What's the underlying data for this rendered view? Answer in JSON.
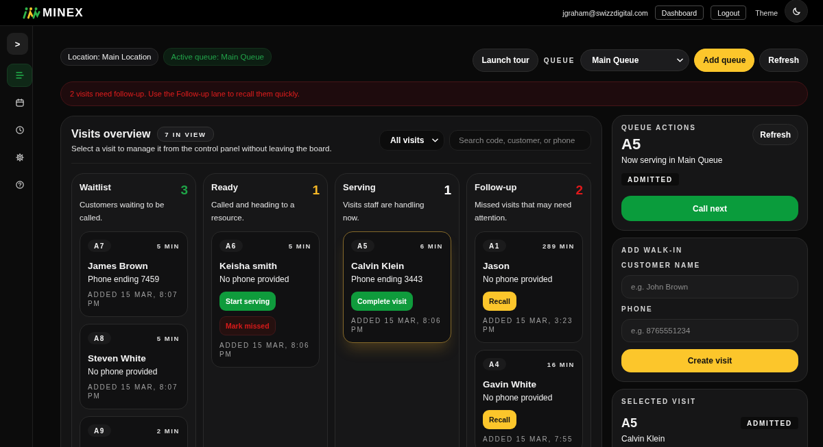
{
  "topbar": {
    "logo": "MINEX",
    "user_email": "jgraham@swizzdigital.com",
    "links": [
      {
        "label": "Dashboard"
      },
      {
        "label": "Logout"
      }
    ],
    "theme_label": "Theme"
  },
  "sidebar": {
    "toggle": ">",
    "items": [
      {
        "kind": "list",
        "selected": true
      },
      {
        "kind": "calendar",
        "selected": false
      },
      {
        "kind": "clock",
        "selected": false
      },
      {
        "kind": "gear",
        "selected": false
      },
      {
        "kind": "help",
        "selected": false
      }
    ]
  },
  "header": {
    "chips": [
      {
        "kind": "location",
        "label": "Location: Main Location"
      },
      {
        "kind": "active",
        "label": "Active queue: Main Queue"
      }
    ],
    "launch_tour": "Launch tour",
    "queue_label": "QUEUE",
    "queue_select": "Main Queue",
    "add_queue": "Add queue",
    "refresh": "Refresh"
  },
  "alert": {
    "text": "2 visits need follow-up. Use the Follow-up lane to recall them quickly."
  },
  "board": {
    "title": "Visits overview",
    "count_badge": "7 IN VIEW",
    "subtitle": "Select a visit to manage it from the control panel without leaving the board.",
    "filter": "All visits",
    "search": {
      "placeholder": "Search code, customer, or phone"
    },
    "lanes": [
      {
        "title": "Waitlist",
        "count": "3",
        "color": "#1fa347",
        "description": "Customers waiting to be called.",
        "cards": [
          {
            "code": "A7",
            "wait": "5 MIN",
            "name": "James Brown",
            "phone": "Phone ending 7459",
            "added": "ADDED 15 MAR, 8:07 PM",
            "selected": false
          },
          {
            "code": "A8",
            "wait": "5 MIN",
            "name": "Steven White",
            "phone": "No phone provided",
            "added": "ADDED 15 MAR, 8:07 PM",
            "selected": false
          },
          {
            "code": "A9",
            "wait": "2 MIN",
            "selected": false
          }
        ]
      },
      {
        "title": "Ready",
        "count": "1",
        "color": "#f6b826",
        "description": "Called and heading to a resource.",
        "cards": [
          {
            "code": "A6",
            "wait": "5 MIN",
            "name": "Keisha smith",
            "phone": "No phone provided",
            "actions": [
              {
                "label": "Start serving",
                "kind": "success"
              },
              {
                "label": "Mark missed",
                "kind": "danger"
              }
            ],
            "added": "ADDED 15 MAR, 8:06 PM",
            "selected": false
          }
        ]
      },
      {
        "title": "Serving",
        "count": "1",
        "color": "#ffffff",
        "description": "Visits staff are handling now.",
        "cards": [
          {
            "code": "A5",
            "wait": "6 MIN",
            "name": "Calvin Klein",
            "phone": "Phone ending 3443",
            "actions": [
              {
                "label": "Complete visit",
                "kind": "success"
              }
            ],
            "added": "ADDED 15 MAR, 8:06 PM",
            "selected": true
          }
        ]
      },
      {
        "title": "Follow-up",
        "count": "2",
        "color": "#e0191b",
        "description": "Missed visits that may need attention.",
        "cards": [
          {
            "code": "A1",
            "wait": "289 MIN",
            "name": "Jason",
            "phone": "No phone provided",
            "actions": [
              {
                "label": "Recall",
                "kind": "warning"
              }
            ],
            "added": "ADDED 15 MAR, 3:23 PM",
            "selected": false
          },
          {
            "code": "A4",
            "wait": "16 MIN",
            "name": "Gavin White",
            "phone": "No phone provided",
            "actions": [
              {
                "label": "Recall",
                "kind": "warning"
              }
            ],
            "added": "ADDED 15 MAR, 7:55",
            "selected": false
          }
        ]
      }
    ]
  },
  "queue_actions": {
    "heading": "QUEUE ACTIONS",
    "refresh": "Refresh",
    "code": "A5",
    "status_text": "Now serving in Main Queue",
    "badge": "ADMITTED",
    "call_next": "Call next"
  },
  "walk_in": {
    "heading": "ADD WALK-IN",
    "fields": [
      {
        "label": "CUSTOMER NAME",
        "placeholder": "e.g. John Brown"
      },
      {
        "label": "PHONE",
        "placeholder": "e.g. 8765551234"
      }
    ],
    "submit": "Create visit"
  },
  "selected_visit": {
    "heading": "SELECTED VISIT",
    "code": "A5",
    "badge": "ADMITTED",
    "name": "Calvin Klein"
  }
}
